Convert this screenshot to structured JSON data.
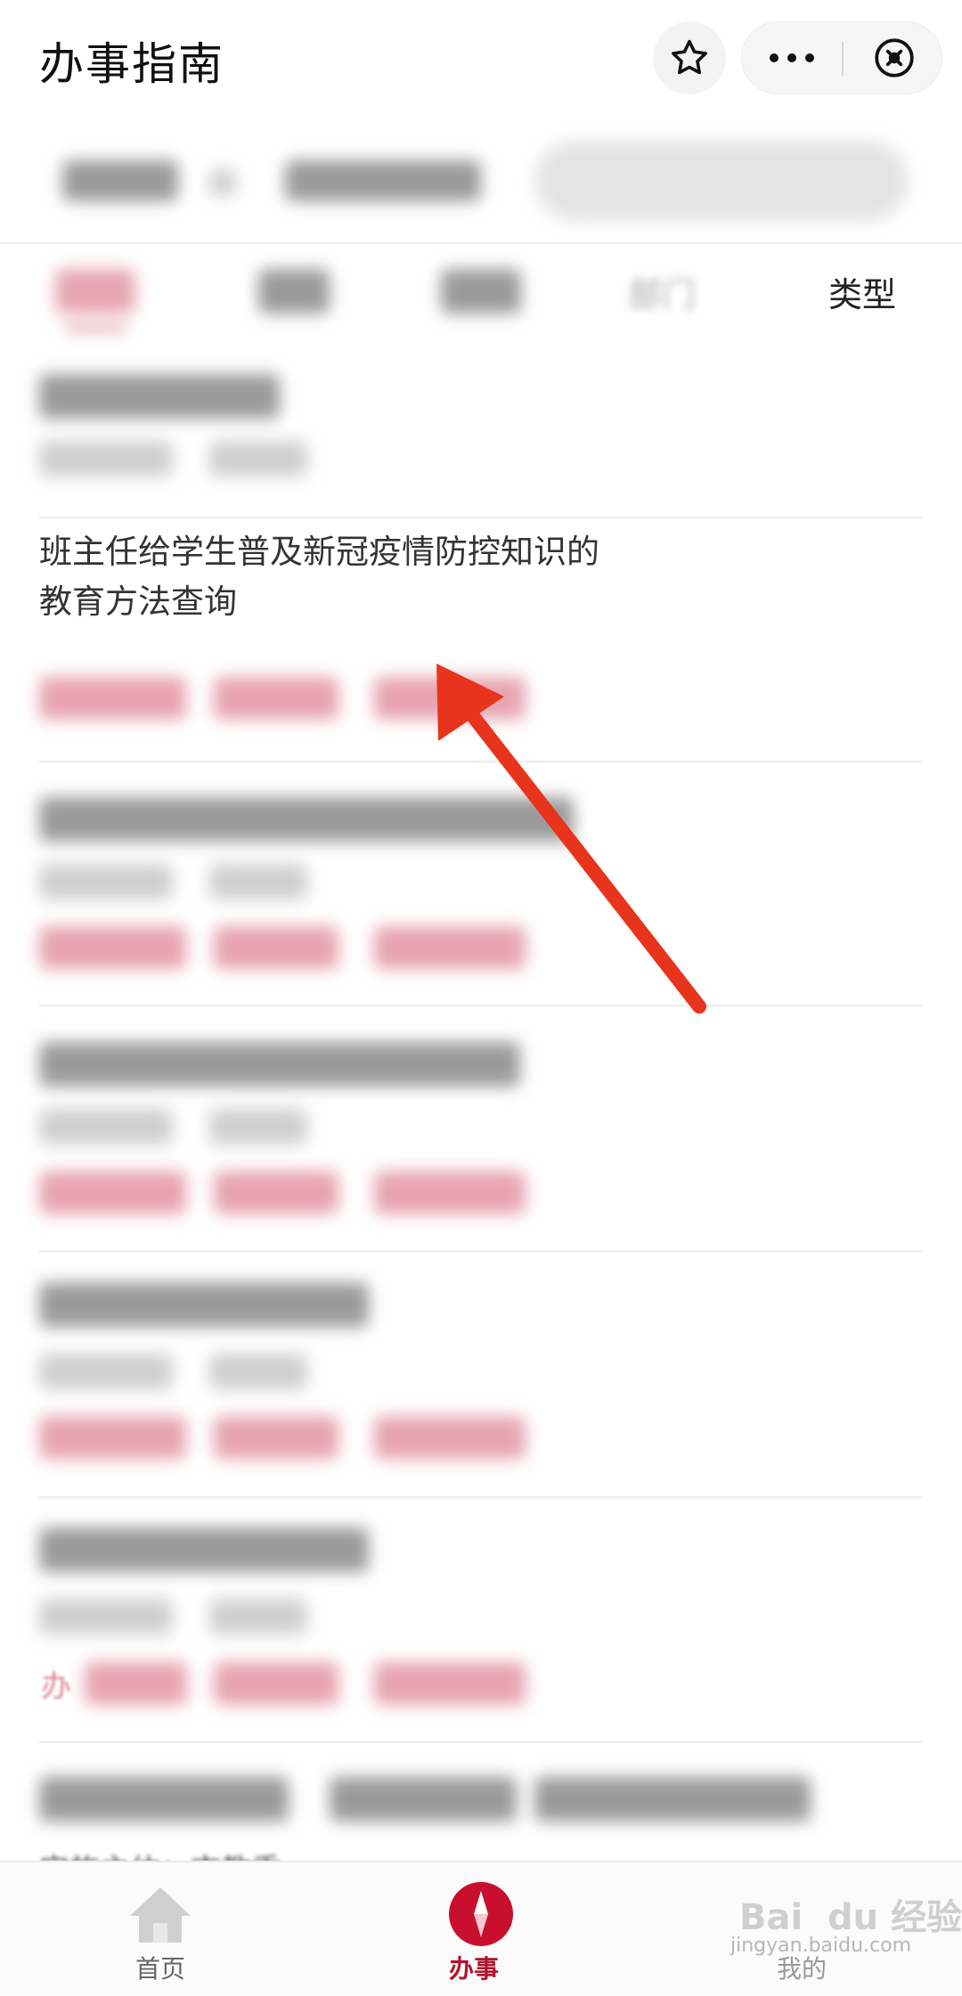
{
  "header": {
    "title": "办事指南",
    "star_icon": "star-icon",
    "more_icon": "more-icon",
    "close_icon": "close-circle-icon"
  },
  "tabs": {
    "dept_label": "部门",
    "type_label": "类型"
  },
  "list": {
    "item2_title": "班主任给学生普及新冠疫情防控知识的教育方法查询"
  },
  "partial_text": {
    "handle_label": "办",
    "org_line": "实施主体：市教委"
  },
  "bottom_nav": {
    "home_label": "首页",
    "handle_label": "办事",
    "mine_label": "我的"
  },
  "watermark": {
    "text": "jingyan.baidu.com",
    "brand": "Bai  du 经验"
  },
  "colors": {
    "accent": "#c8102e",
    "arrow": "#e8341c"
  }
}
